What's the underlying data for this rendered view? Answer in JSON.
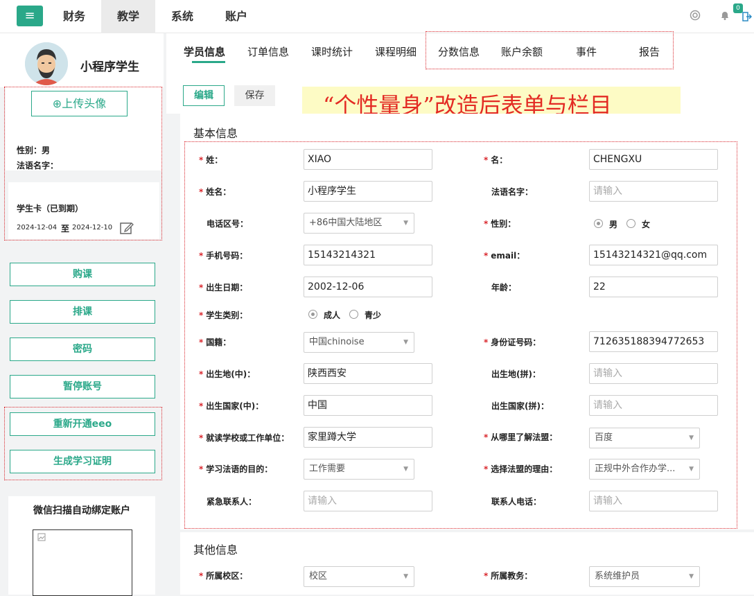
{
  "topbar": {
    "menu_icon": "menu-icon",
    "nav": [
      "财务",
      "教学",
      "系统",
      "账户"
    ],
    "active_nav": "教学",
    "notification_count": "0",
    "icons": [
      "help-lifebuoy-icon",
      "bell-icon",
      "logout-icon"
    ]
  },
  "profile": {
    "name": "小程序学生",
    "upload_label": "⊕上传头像",
    "gender_label": "性别：男",
    "french_name_label": "法语名字：",
    "card_status": "学生卡（已到期）",
    "card_start": "2024-12-04",
    "card_to": "至",
    "card_end": "2024-12-10"
  },
  "sidebar_buttons": [
    "购课",
    "排课",
    "密码",
    "暂停账号",
    "重新开通eeo",
    "生成学习证明"
  ],
  "wechat": {
    "title": "微信扫描自动绑定账户"
  },
  "tabs": [
    "学员信息",
    "订单信息",
    "课时统计",
    "课程明细",
    "分数信息",
    "账户余额",
    "事件",
    "报告"
  ],
  "actions": {
    "edit": "编辑",
    "save": "保存"
  },
  "banner": "“个性量身”改造后表单与栏目",
  "basic": {
    "title": "基本信息",
    "surname_label": "姓：",
    "surname": "XIAO",
    "given_label": "名：",
    "given": "CHENGXU",
    "fullname_label": "姓名：",
    "fullname": "小程序学生",
    "frname_label": "法语名字：",
    "frname_ph": "请输入",
    "areacode_label": "电话区号：",
    "areacode": "+86中国大陆地区",
    "gender_label": "性别：",
    "gender_male": "男",
    "gender_female": "女",
    "mobile_label": "手机号码：",
    "mobile": "15143214321",
    "email_label": "email：",
    "email": "15143214321@qq.com",
    "birth_label": "出生日期：",
    "birth": "2002-12-06",
    "age_label": "年龄：",
    "age": "22",
    "type_label": "学生类别：",
    "type_adult": "成人",
    "type_teen": "青少",
    "nation_label": "国籍：",
    "nation": "中国chinoise",
    "id_label": "身份证号码：",
    "id": "712635188394772653",
    "birthplace_cn_label": "出生地(中)：",
    "birthplace_cn": "陕西西安",
    "birthplace_py_label": "出生地(拼)：",
    "birthplace_py_ph": "请输入",
    "country_cn_label": "出生国家(中)：",
    "country_cn": "中国",
    "country_py_label": "出生国家(拼)：",
    "country_py_ph": "请输入",
    "school_label": "就读学校或工作单位：",
    "school": "家里蹲大学",
    "source_label": "从哪里了解法盟：",
    "source": "百度",
    "purpose_label": "学习法语的目的：",
    "purpose": "工作需要",
    "reason_label": "选择法盟的理由：",
    "reason": "正规中外合作办学...",
    "emergency_label": "紧急联系人：",
    "emergency_ph": "请输入",
    "contact_phone_label": "联系人电话：",
    "contact_phone_ph": "请输入"
  },
  "other": {
    "title": "其他信息",
    "campus_label": "所属校区：",
    "campus": "校区",
    "affairs_label": "所属教务：",
    "affairs": "系统维护员"
  }
}
